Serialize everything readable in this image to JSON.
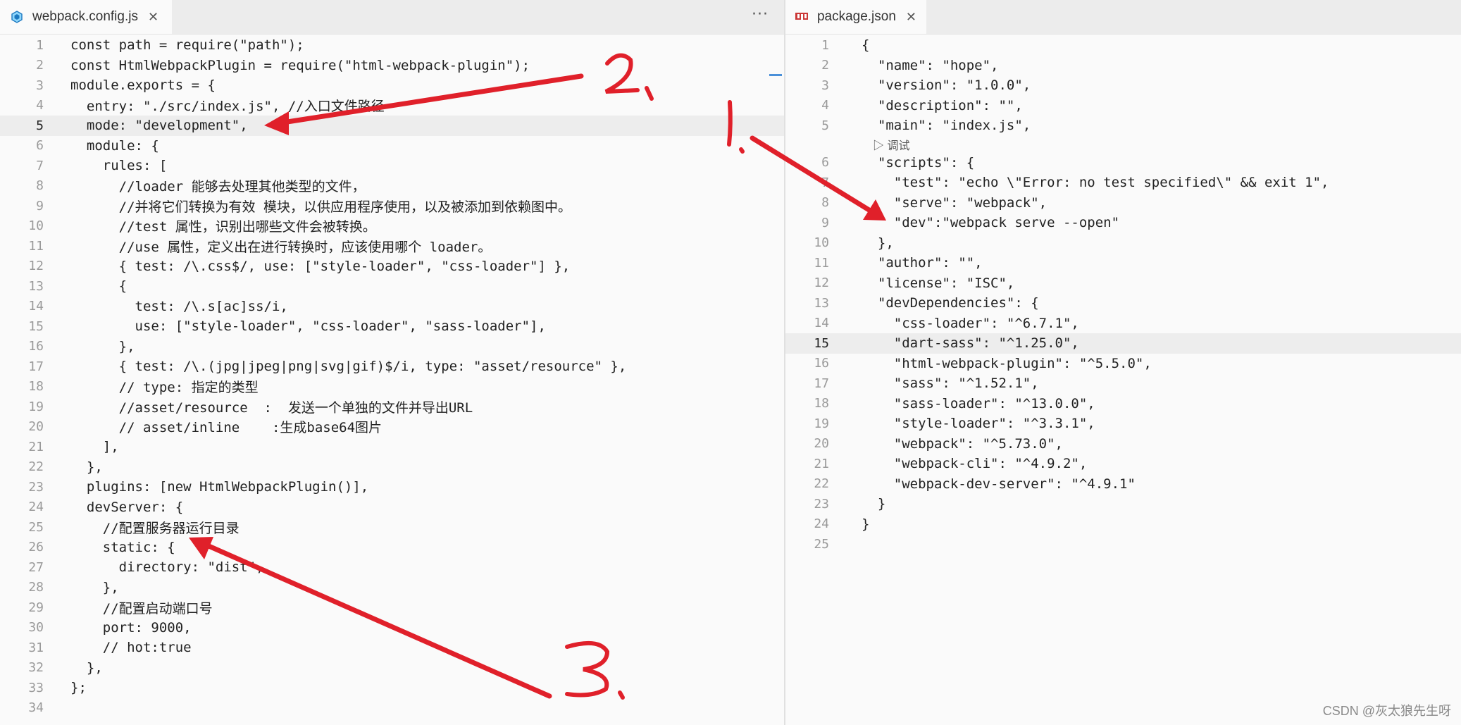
{
  "left_tab": {
    "title": "webpack.config.js",
    "close": "✕",
    "more": "···"
  },
  "right_tab": {
    "title": "package.json",
    "close": "✕"
  },
  "left_current_line": 5,
  "right_current_line": 15,
  "left_lines": [
    "const path = require(\"path\");",
    "const HtmlWebpackPlugin = require(\"html-webpack-plugin\");",
    "module.exports = {",
    "  entry: \"./src/index.js\", //入口文件路径",
    "  mode: \"development\",",
    "  module: {",
    "    rules: [",
    "      //loader 能够去处理其他类型的文件，",
    "      //并将它们转换为有效 模块，以供应用程序使用，以及被添加到依赖图中。",
    "      //test 属性，识别出哪些文件会被转换。",
    "      //use 属性，定义出在进行转换时，应该使用哪个 loader。",
    "      { test: /\\.css$/, use: [\"style-loader\", \"css-loader\"] },",
    "      {",
    "        test: /\\.s[ac]ss/i,",
    "        use: [\"style-loader\", \"css-loader\", \"sass-loader\"],",
    "      },",
    "      { test: /\\.(jpg|jpeg|png|svg|gif)$/i, type: \"asset/resource\" },",
    "      // type: 指定的类型",
    "      //asset/resource  :  发送一个单独的文件并导出URL",
    "      // asset/inline    :生成base64图片",
    "    ],",
    "  },",
    "  plugins: [new HtmlWebpackPlugin()],",
    "  devServer: {",
    "    //配置服务器运行目录",
    "    static: {",
    "      directory: \"dist\",",
    "    },",
    "    //配置启动端口号",
    "    port: 9000,",
    "    // hot:true",
    "  },",
    "};",
    ""
  ],
  "right_lines": [
    "{",
    "  \"name\": \"hope\",",
    "  \"version\": \"1.0.0\",",
    "  \"description\": \"\",",
    "  \"main\": \"index.js\",",
    "  \"scripts\": {",
    "    \"test\": \"echo \\\"Error: no test specified\\\" && exit 1\",",
    "    \"serve\": \"webpack\",",
    "    \"dev\":\"webpack serve --open\"",
    "  },",
    "  \"author\": \"\",",
    "  \"license\": \"ISC\",",
    "  \"devDependencies\": {",
    "    \"css-loader\": \"^6.7.1\",",
    "    \"dart-sass\": \"^1.25.0\",",
    "    \"html-webpack-plugin\": \"^5.5.0\",",
    "    \"sass\": \"^1.52.1\",",
    "    \"sass-loader\": \"^13.0.0\",",
    "    \"style-loader\": \"^3.3.1\",",
    "    \"webpack\": \"^5.73.0\",",
    "    \"webpack-cli\": \"^4.9.2\",",
    "    \"webpack-dev-server\": \"^4.9.1\"",
    "  }",
    "}",
    ""
  ],
  "debug_codelens": "▷ 调试",
  "annotations": [
    "2,",
    "1.",
    "3."
  ],
  "watermark": "CSDN @灰太狼先生呀",
  "colors": {
    "arrow": "#e0202a",
    "tab_active": "#fafafa",
    "line_highlight": "#ededed"
  }
}
